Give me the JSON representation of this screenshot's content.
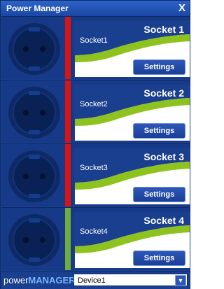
{
  "window": {
    "title": "Power Manager",
    "close_glyph": "X"
  },
  "sockets": [
    {
      "title": "Socket 1",
      "label": "Socket1",
      "settings_label": "Settings",
      "status_color": "#d91414"
    },
    {
      "title": "Socket 2",
      "label": "Socket2",
      "settings_label": "Settings",
      "status_color": "#d91414"
    },
    {
      "title": "Socket 3",
      "label": "Socket3",
      "settings_label": "Settings",
      "status_color": "#d91414"
    },
    {
      "title": "Socket 4",
      "label": "Socket4",
      "settings_label": "Settings",
      "status_color": "#6fae3e"
    }
  ],
  "footer": {
    "brand_left": "power",
    "brand_right": "MANAGER",
    "device_selected": "Device1",
    "dropdown_icon": "chevron-down-icon"
  },
  "colors": {
    "window_blue": "#1b3f8f",
    "accent_green": "#8ec21f",
    "status_off": "#d91414",
    "status_on": "#6fae3e"
  }
}
